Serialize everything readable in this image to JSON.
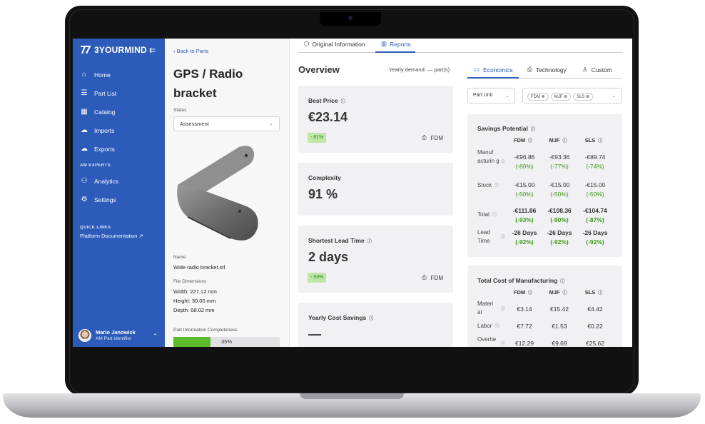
{
  "sidebar": {
    "brand": "3YOURMIND",
    "items": [
      {
        "label": "Home",
        "icon": "home-icon"
      },
      {
        "label": "Part List",
        "icon": "list-icon"
      },
      {
        "label": "Catalog",
        "icon": "catalog-icon"
      },
      {
        "label": "Imports",
        "icon": "cloud-download-icon"
      },
      {
        "label": "Exports",
        "icon": "cloud-upload-icon"
      }
    ],
    "section_am": "AM EXPERTS",
    "am_items": [
      {
        "label": "Analytics",
        "icon": "analytics-icon"
      },
      {
        "label": "Settings",
        "icon": "settings-icon"
      }
    ],
    "section_links": "QUICK LINKS",
    "quick_link": "Platform Documentation",
    "user": {
      "name": "Mario Janowick",
      "role": "AM Part Identifier"
    }
  },
  "part": {
    "back": "Back to Parts",
    "title": "GPS / Radio bracket",
    "status_label": "Status",
    "status_value": "Assessment",
    "name_label": "Name",
    "name_value": "Wide radio bracket.stl",
    "dims_label": "File Dimensions",
    "width": "Width: 227.12 mm",
    "height": "Height: 30.00 mm",
    "depth": "Depth: 68.02 mm",
    "completeness_label": "Part Information Completeness",
    "completeness_text": "35%",
    "completeness_value": 0.35
  },
  "main": {
    "tabs": [
      {
        "label": "Original Information",
        "active": false
      },
      {
        "label": "Reports",
        "active": true
      }
    ],
    "overview": "Overview",
    "yearly_demand": "Yearly demand: — part(s)",
    "cards": {
      "best_price": {
        "title": "Best Price",
        "value": "€23.14",
        "badge": "- 81%",
        "tech": "FDM"
      },
      "complexity": {
        "title": "Complexity",
        "value": "91 %"
      },
      "lead_time": {
        "title": "Shortest Lead Time",
        "value": "2 days",
        "badge": "- 93%",
        "tech": "FDM"
      },
      "yearly_savings": {
        "title": "Yearly Cost Savings",
        "value": "—"
      }
    }
  },
  "right": {
    "tabs": [
      {
        "label": "Economics",
        "active": true
      },
      {
        "label": "Technology",
        "active": false
      },
      {
        "label": "Custom",
        "active": false
      }
    ],
    "unit_select": "Part Unit",
    "chips": [
      "FDM",
      "MJF",
      "SLS"
    ],
    "savings": {
      "title": "Savings Potential",
      "cols": [
        "FDM",
        "MJF",
        "SLS"
      ],
      "rows": [
        {
          "label": "Manuf acturin g",
          "cells": [
            [
              "-€96.86",
              "(-80%)"
            ],
            [
              "-€93.36",
              "(-77%)"
            ],
            [
              "-€89.74",
              "(-74%)"
            ]
          ]
        },
        {
          "label": "Stock",
          "cells": [
            [
              "-€15.00",
              "(-50%)"
            ],
            [
              "-€15.00",
              "(-50%)"
            ],
            [
              "-€15.00",
              "(-50%)"
            ]
          ]
        },
        {
          "label": "Total",
          "cells": [
            [
              "-€111.86",
              "(-93%)"
            ],
            [
              "-€108.36",
              "(-90%)"
            ],
            [
              "-€104.74",
              "(-87%)"
            ]
          ]
        },
        {
          "label": "Lead Time",
          "cells": [
            [
              "-26 Days",
              "(-92%)"
            ],
            [
              "-26 Days",
              "(-92%)"
            ],
            [
              "-26 Days",
              "(-92%)"
            ]
          ]
        }
      ]
    },
    "cost": {
      "title": "Total Cost of Manufacturing",
      "cols": [
        "FDM",
        "MJF",
        "SLS"
      ],
      "rows": [
        {
          "label": "Materi al",
          "cells": [
            "€3.14",
            "€15.42",
            "€4.42"
          ]
        },
        {
          "label": "Labor",
          "cells": [
            "€7.72",
            "€1.53",
            "€0.22"
          ]
        },
        {
          "label": "Overhe",
          "cells": [
            "€12.29",
            "€9.69",
            "€25.62"
          ]
        }
      ]
    }
  },
  "colors": {
    "brand": "#2c5bb9",
    "positive": "#3a9a17",
    "progress": "#5cbb2a"
  }
}
